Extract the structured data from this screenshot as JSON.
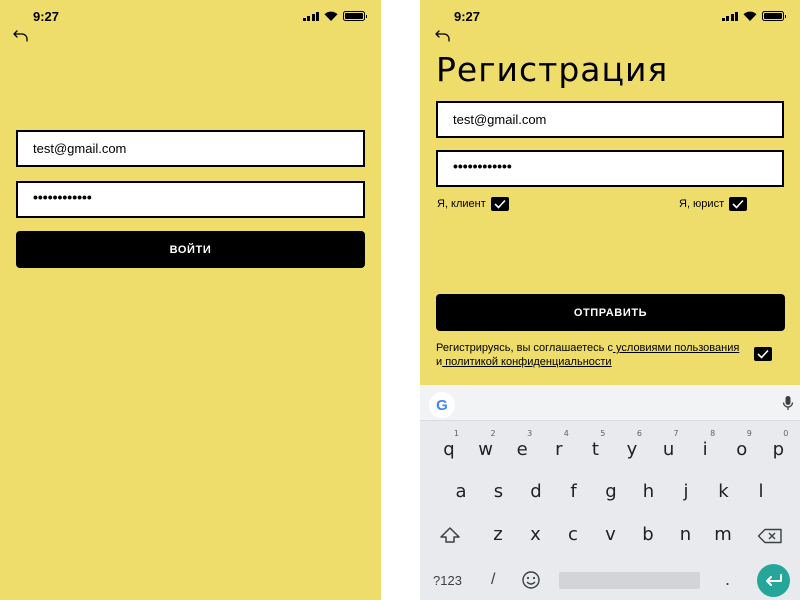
{
  "status": {
    "time": "9:27"
  },
  "login": {
    "email_value": "test@gmail.com",
    "password_value": "••••••••••••",
    "submit_label": "ВОЙТИ"
  },
  "register": {
    "title": "Регистрация",
    "email_value": "test@gmail.com",
    "password_value": "••••••••••••",
    "role_client_label": "Я, клиент",
    "role_client_checked": true,
    "role_lawyer_label": "Я, юрист",
    "role_lawyer_checked": true,
    "submit_label": "ОТПРАВИТЬ",
    "agreement": {
      "prefix": "Регистрируясь, вы соглашаетесь с",
      "terms_link": " условиями пользования",
      "conjunction": " и",
      "privacy_link": " политикой конфиденциальности",
      "checked": true
    }
  },
  "keyboard": {
    "row1": [
      {
        "key": "q",
        "hint": "1"
      },
      {
        "key": "w",
        "hint": "2"
      },
      {
        "key": "e",
        "hint": "3"
      },
      {
        "key": "r",
        "hint": "4"
      },
      {
        "key": "t",
        "hint": "5"
      },
      {
        "key": "y",
        "hint": "6"
      },
      {
        "key": "u",
        "hint": "7"
      },
      {
        "key": "i",
        "hint": "8"
      },
      {
        "key": "o",
        "hint": "9"
      },
      {
        "key": "p",
        "hint": "0"
      }
    ],
    "row2": [
      "a",
      "s",
      "d",
      "f",
      "g",
      "h",
      "j",
      "k",
      "l"
    ],
    "row3": [
      "z",
      "x",
      "c",
      "v",
      "b",
      "n",
      "m"
    ],
    "symbols_label": "?123",
    "slash_label": "/",
    "period_label": ".",
    "google_label": "G",
    "accent_color": "#26A69A",
    "background_color": "#EEDD6B"
  }
}
